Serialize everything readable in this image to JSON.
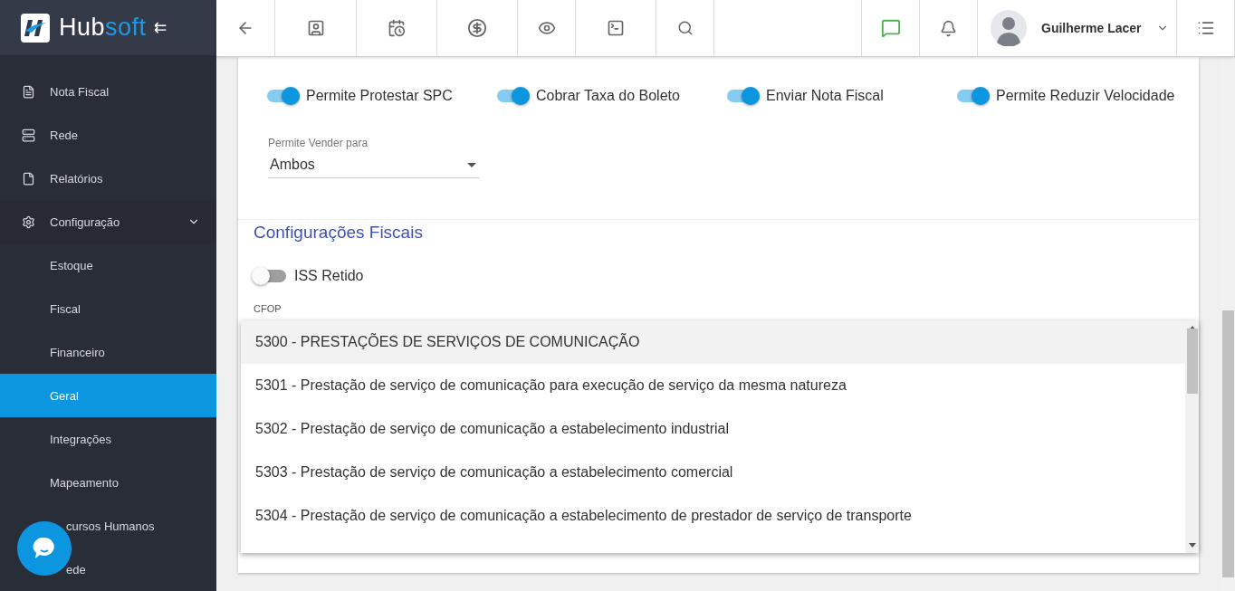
{
  "brand": {
    "name_a": "Hub",
    "name_b": "soft",
    "collapse": "⇇"
  },
  "toolbar": {
    "user": "Guilherme Lacer"
  },
  "sidebar": {
    "items": [
      {
        "label": "Nota Fiscal",
        "kind": "top",
        "selected": false
      },
      {
        "label": "Rede",
        "kind": "top",
        "selected": false
      },
      {
        "label": "Relatórios",
        "kind": "top",
        "selected": false
      },
      {
        "label": "Configuração",
        "kind": "group",
        "expanded": true,
        "selected": false
      },
      {
        "label": "Estoque",
        "kind": "sub",
        "selected": false
      },
      {
        "label": "Fiscal",
        "kind": "sub",
        "selected": false
      },
      {
        "label": "Financeiro",
        "kind": "sub",
        "selected": false
      },
      {
        "label": "Geral",
        "kind": "sub",
        "selected": true
      },
      {
        "label": "Integrações",
        "kind": "sub",
        "selected": false
      },
      {
        "label": "Mapeamento",
        "kind": "sub",
        "selected": false
      },
      {
        "label": "cursos Humanos",
        "kind": "covered",
        "selected": false
      },
      {
        "label": "ede",
        "kind": "covered",
        "selected": false
      }
    ]
  },
  "switches": [
    {
      "label": "Permite Protestar SPC",
      "on": true
    },
    {
      "label": "Cobrar Taxa do Boleto",
      "on": true
    },
    {
      "label": "Enviar Nota Fiscal",
      "on": true
    },
    {
      "label": "Permite Reduzir Velocidade",
      "on": true
    }
  ],
  "sell_to": {
    "label": "Permite Vender para",
    "value": "Ambos"
  },
  "fiscal": {
    "title": "Configurações Fiscais",
    "iss": {
      "label": "ISS Retido",
      "on": false
    },
    "cfop_label": "CFOP"
  },
  "cfop_options": [
    {
      "label": "5300 - PRESTAÇÕES DE SERVIÇOS DE COMUNICAÇÃO",
      "selected": true
    },
    {
      "label": "5301 - Prestação de serviço de comunicação para execução de serviço da mesma natureza",
      "selected": false
    },
    {
      "label": "5302 - Prestação de serviço de comunicação a estabelecimento industrial",
      "selected": false
    },
    {
      "label": "5303 - Prestação de serviço de comunicação a estabelecimento comercial",
      "selected": false
    },
    {
      "label": "5304 - Prestação de serviço de comunicação a estabelecimento de prestador de serviço de transporte",
      "selected": false
    }
  ]
}
